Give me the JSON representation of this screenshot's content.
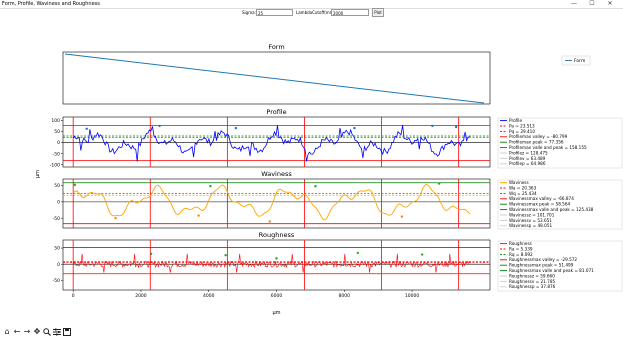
{
  "window": {
    "title": "Form, Profile, Waviness and Roughness",
    "minimize_label": "—",
    "maximize_label": "☐",
    "close_label": "✕"
  },
  "controls": {
    "sigma_label": "Sigma:",
    "sigma_value": "25",
    "lambda_label": "LambdaCutoff(mm):",
    "lambda_value": "2000",
    "plot_button": "Plot"
  },
  "toolbar": {
    "icons": [
      "home-icon",
      "back-arrow-icon",
      "forward-arrow-icon",
      "pan-icon",
      "zoom-icon",
      "configure-subplots-icon",
      "save-icon"
    ]
  },
  "figure": {
    "xlabel": "μm",
    "ylabel": "μm",
    "xticks": [
      0,
      2000,
      4000,
      6000,
      8000,
      10000
    ],
    "xlim": [
      -300,
      12300
    ],
    "cutoff_lines": [
      0,
      2275,
      4550,
      6825,
      9100,
      11375
    ],
    "colors": {
      "form": "#1f77b4",
      "profile": "#0000ff",
      "waviness": "#ffa500",
      "roughness": "#ff0000",
      "max_line": "#ff0000",
      "green_line": "#008000",
      "mean_line": "#000000",
      "dashed_red": "#ff0000",
      "dashed_green": "#008000",
      "dashed_orange": "#ffa500"
    }
  },
  "subplots": {
    "form": {
      "title": "Form",
      "legend": [
        "Form"
      ]
    },
    "profile": {
      "title": "Profile",
      "yticks": [
        -100,
        -50,
        0,
        50,
        100
      ],
      "ylim": [
        -110,
        115
      ],
      "legend": [
        "Profile",
        "Pa = 23.513",
        "Pq = 29.410",
        "Profilemax valley = -80.799",
        "Profilemax peak = 77.356",
        "Profilemax valle and peak = 158.155",
        "Profilez = 128.475",
        "Profilev = 63.489",
        "Profilep = 64.986"
      ]
    },
    "waviness": {
      "title": "Waviness",
      "yticks": [
        -50,
        0,
        50
      ],
      "ylim": [
        -80,
        70
      ],
      "legend": [
        "Waviness",
        "Wa = 20.363",
        "Wq = 25.434",
        "Wavinessmax valley = -66.874",
        "Wavinessmax peak = 58.564",
        "Wavinessmax valle and peak = 125.438",
        "Wavinessz = 101.701",
        "Wavinessv = 53.651",
        "Wavinessp = 48.051"
      ]
    },
    "roughness": {
      "title": "Roughness",
      "yticks": [
        -50,
        0,
        50
      ],
      "ylim": [
        -80,
        75
      ],
      "legend": [
        "Roughness",
        "Ra = 5.339",
        "Rq = 8.092",
        "Roughnessmax valley = -29.572",
        "Roughnessmax peak = 51.499",
        "Roughnessmax valle and peak = 81.071",
        "Roughnessz = 59.660",
        "Roughnessv = 21.785",
        "Roughnessp = 37.876"
      ]
    }
  }
}
